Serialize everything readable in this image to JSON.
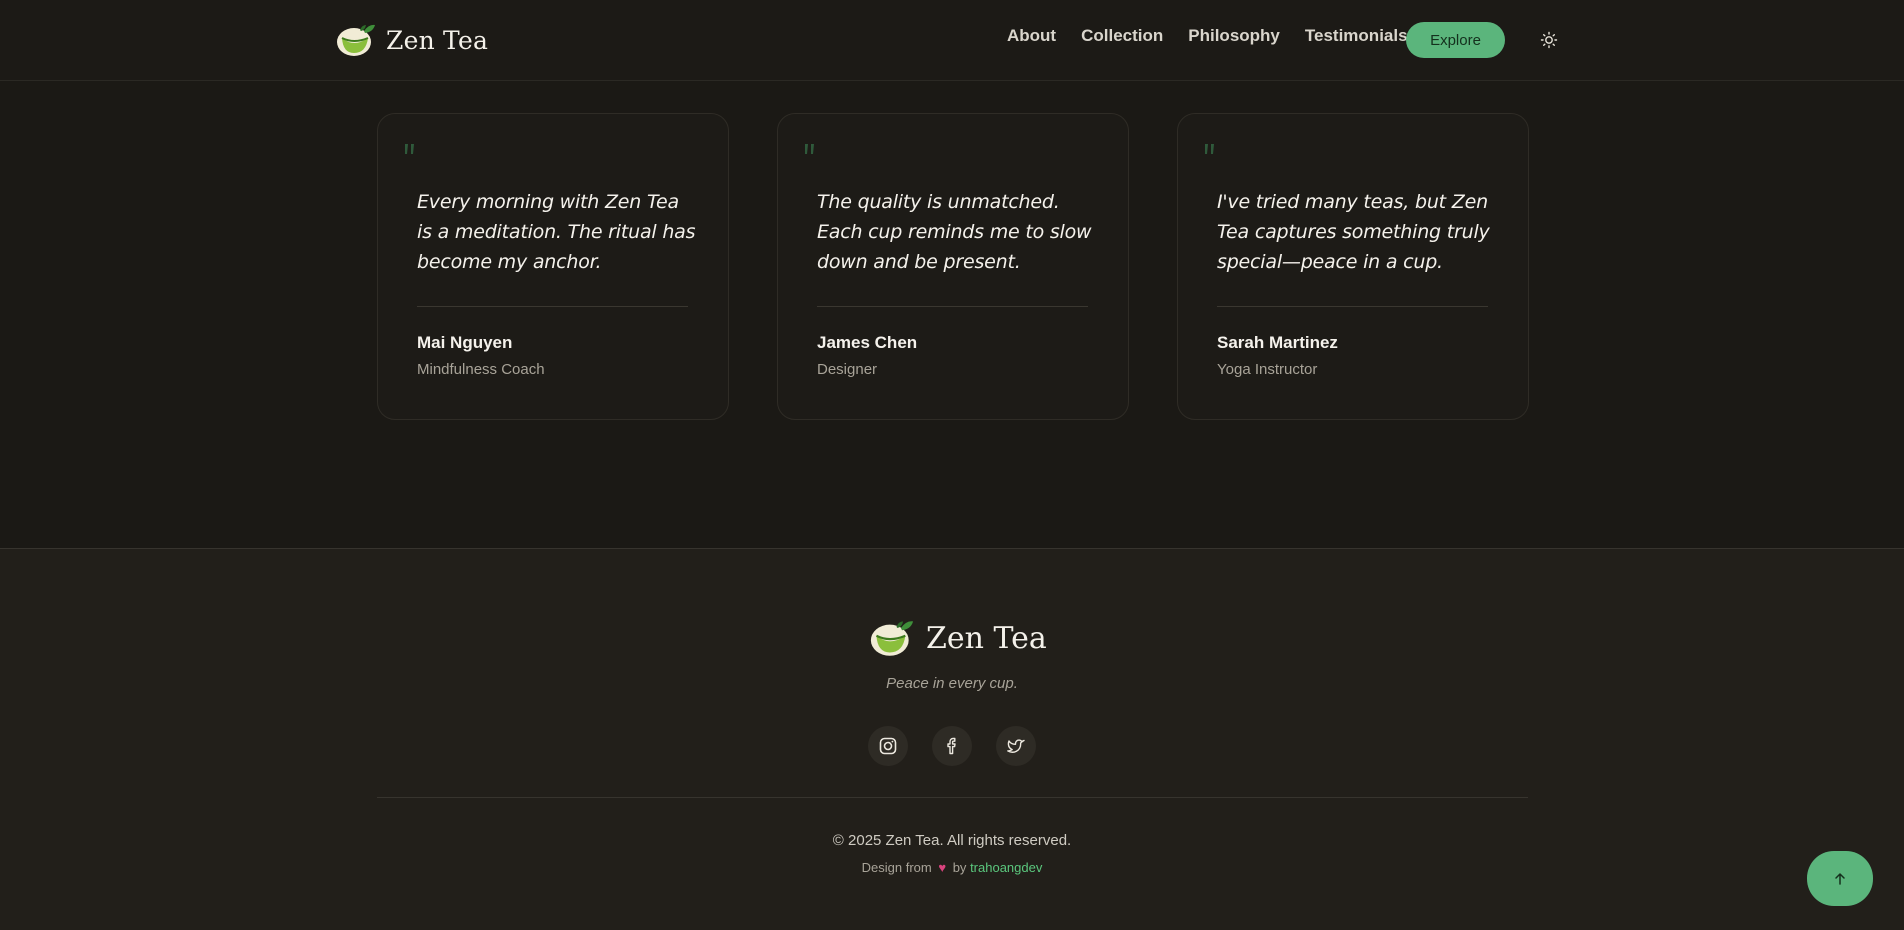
{
  "header": {
    "brand": "Zen Tea",
    "nav": [
      "About",
      "Collection",
      "Philosophy",
      "Testimonials"
    ],
    "explore_label": "Explore",
    "theme_icon": "sun-icon"
  },
  "testimonials": [
    {
      "quote": "Every morning with Zen Tea is a meditation. The ritual has become my anchor.",
      "author": "Mai Nguyen",
      "role": "Mindfulness Coach"
    },
    {
      "quote": "The quality is unmatched. Each cup reminds me to slow down and be present.",
      "author": "James Chen",
      "role": "Designer"
    },
    {
      "quote": "I've tried many teas, but Zen Tea captures something truly special—peace in a cup.",
      "author": "Sarah Martinez",
      "role": "Yoga Instructor"
    }
  ],
  "footer": {
    "brand": "Zen Tea",
    "tagline": "Peace in every cup.",
    "socials": [
      "instagram-icon",
      "facebook-icon",
      "twitter-icon"
    ],
    "copyright": "© 2025 Zen Tea. All rights reserved.",
    "credit_prefix": "Design from",
    "credit_by": "by",
    "credit_author": "trahoangdev"
  },
  "colors": {
    "accent": "#5bb57c",
    "background": "#1b1915",
    "footer_background": "#221f1a",
    "heart": "#d9437e"
  }
}
